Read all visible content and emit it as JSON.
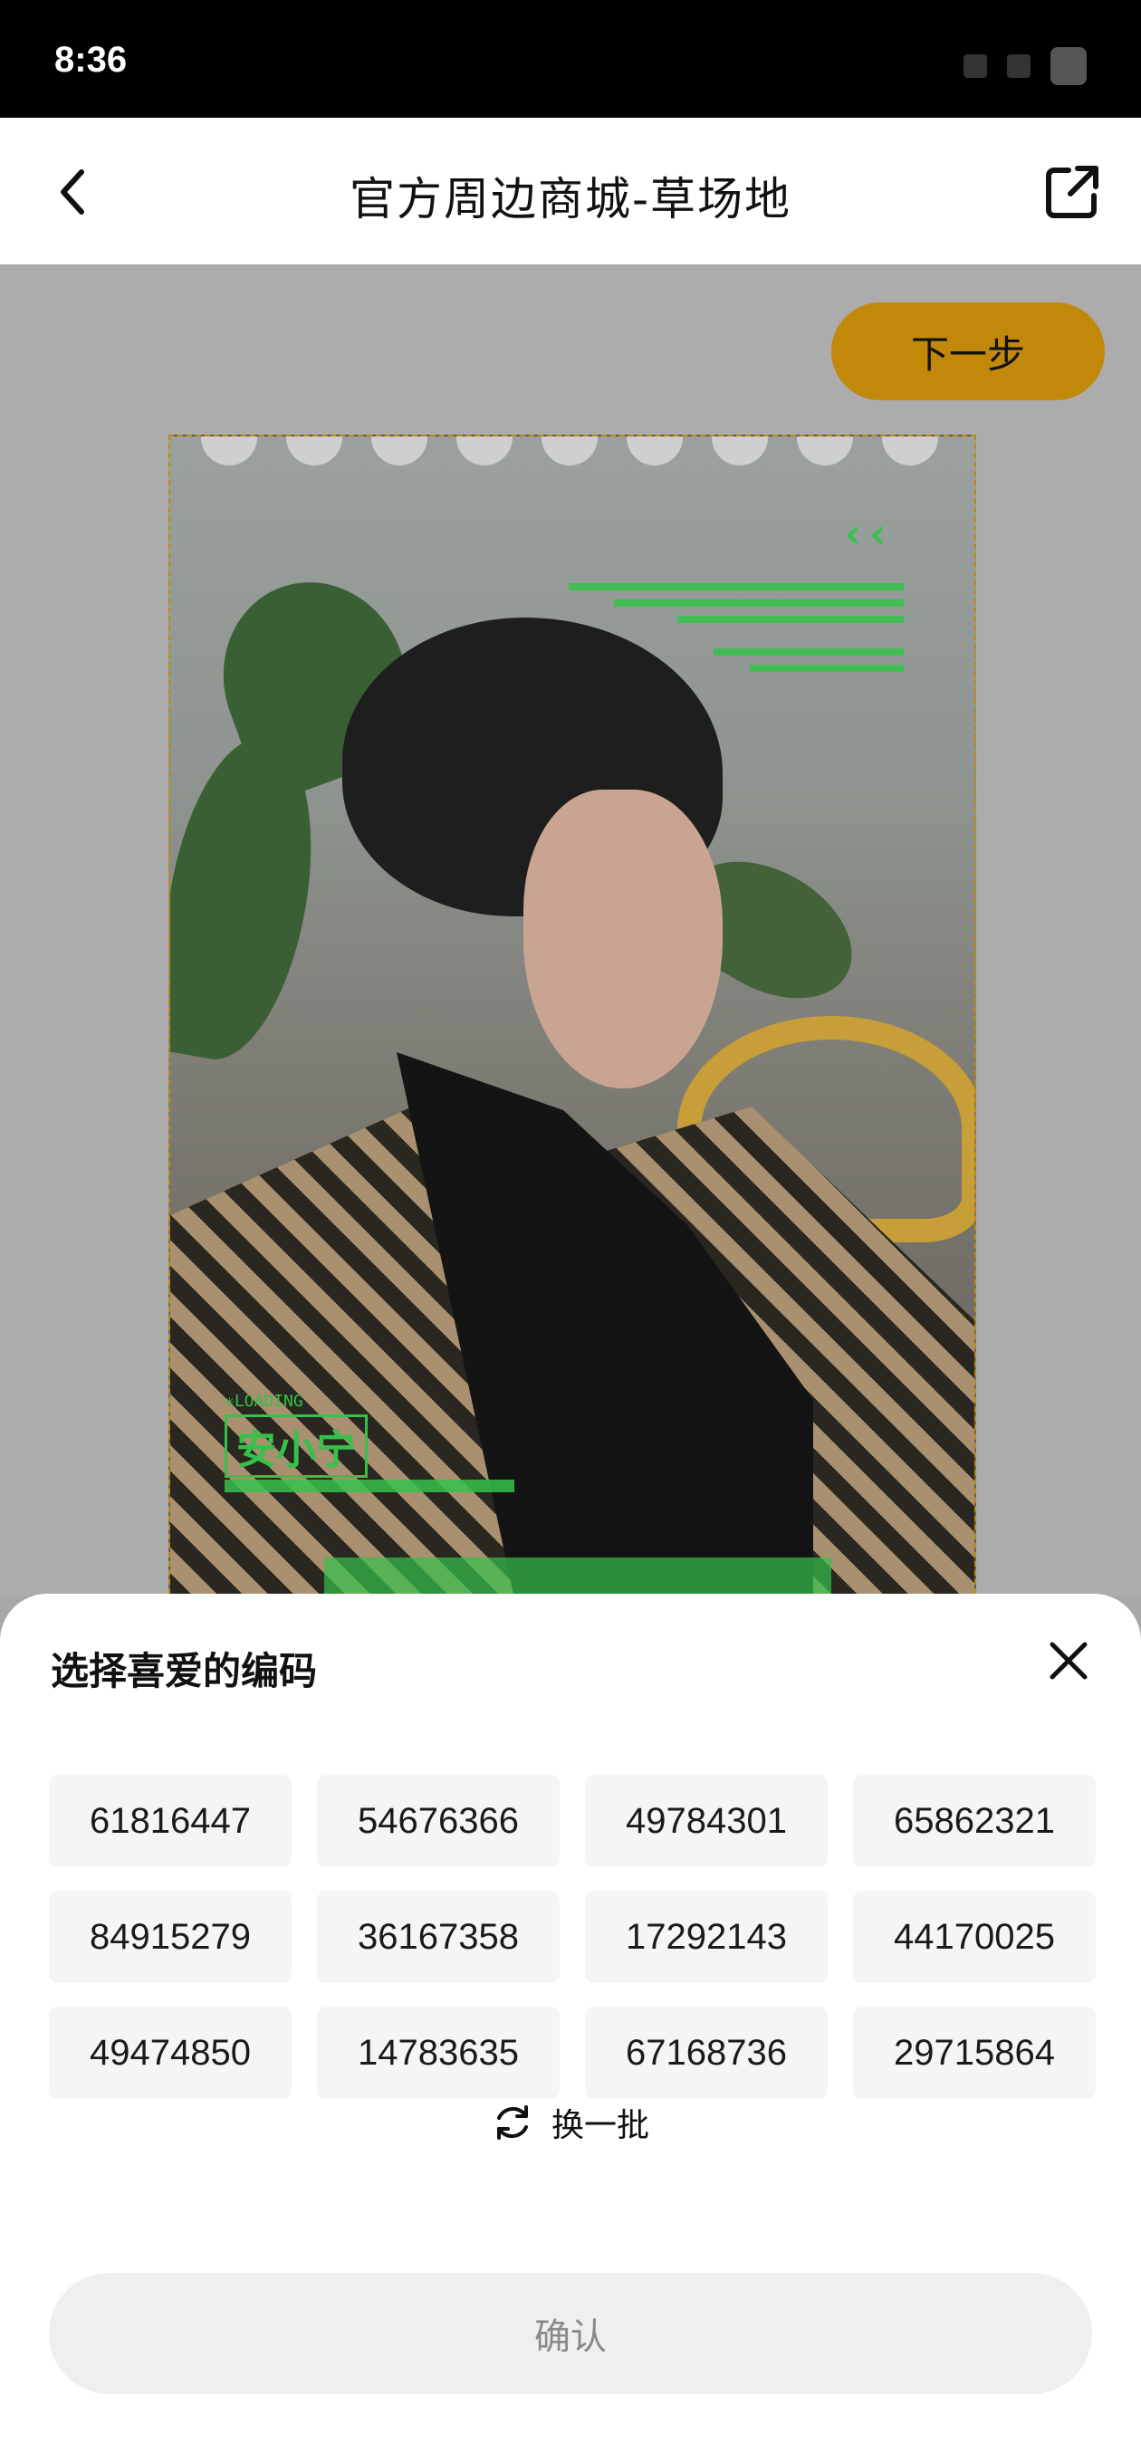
{
  "status_bar": {
    "time": "8:36"
  },
  "nav": {
    "title": "官方周边商城-草场地"
  },
  "toolbar": {
    "next_label": "下一步"
  },
  "photo": {
    "overlay_loading": "✳LOADING",
    "overlay_name": "安小宁",
    "accent_color": "#35c24a"
  },
  "sheet": {
    "title": "选择喜爱的编码",
    "codes": [
      "61816447",
      "54676366",
      "49784301",
      "65862321",
      "84915279",
      "36167358",
      "17292143",
      "44170025",
      "49474850",
      "14783635",
      "67168736",
      "29715864"
    ],
    "refresh_label": "换一批",
    "confirm_label": "确认"
  },
  "colors": {
    "brand": "#c1880a",
    "sheet_bg": "#ffffff",
    "chip_bg": "#f4f5f7"
  }
}
